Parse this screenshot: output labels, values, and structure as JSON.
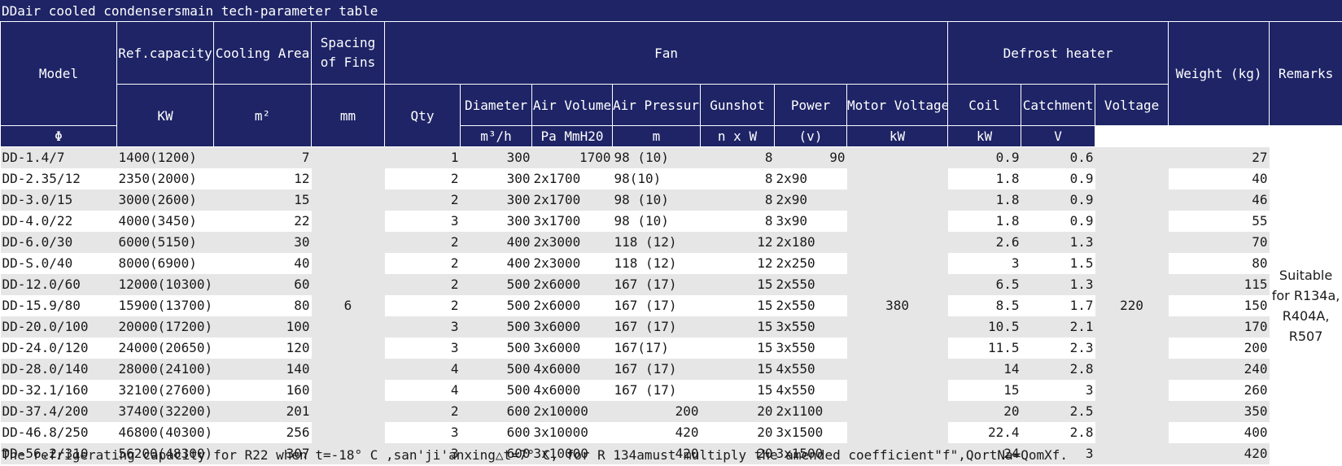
{
  "caption": "DDair cooled condensersmain tech-parameter table",
  "headers": {
    "model": "Model",
    "ref_capacity": "Ref.capacity",
    "cooling_area": "Cooling Area",
    "spacing_of_fins": "Spacing of Fins",
    "fan": "Fan",
    "defrost_heater": "Defrost heater",
    "weight": "Weight (kg)",
    "remarks": "Remarks",
    "qty": "Qty",
    "diameter": "Diameter",
    "air_volume": "Air Volume",
    "air_pressure": "Air Pressure",
    "gunshot": "Gunshot",
    "power": "Power",
    "motor_voltage": "Motor Voltage",
    "coil": "Coil",
    "catchment": "Catchment",
    "voltage": "Voltage",
    "unit_kw": "KW",
    "unit_m2": "m²",
    "unit_mm": "mm",
    "unit_diameter": "Φ",
    "unit_air_volume": "m³/h",
    "unit_air_pressure": "Pa  MmH20",
    "unit_gunshot": "m",
    "unit_power": "n x W",
    "unit_motor_voltage": "(v)",
    "unit_coil": "kW",
    "unit_catchment": "kW",
    "unit_voltage": "V"
  },
  "shared": {
    "spacing_of_fins": "6",
    "motor_voltage": "380",
    "heater_voltage": "220",
    "remarks": "Suitable for R134a, R404A, R507"
  },
  "rows": [
    {
      "model": "DD-1.4/7",
      "capacity": "1400(1200)",
      "area": "7",
      "qty": "1",
      "diameter": "300",
      "air_volume": "1700",
      "air_pressure": "98 (10)",
      "gunshot": "8",
      "power": "90",
      "coil": "0.9",
      "catchment": "0.6",
      "weight": "27"
    },
    {
      "model": "DD-2.35/12",
      "capacity": "2350(2000)",
      "area": "12",
      "qty": "2",
      "diameter": "300",
      "air_volume": "2x1700",
      "air_pressure": "98(10)",
      "gunshot": "8",
      "power": "2x90",
      "coil": "1.8",
      "catchment": "0.9",
      "weight": "40"
    },
    {
      "model": "DD-3.0/15",
      "capacity": "3000(2600)",
      "area": "15",
      "qty": "2",
      "diameter": "300",
      "air_volume": "2x1700",
      "air_pressure": "98 (10)",
      "gunshot": "8",
      "power": "2x90",
      "coil": "1.8",
      "catchment": "0.9",
      "weight": "46"
    },
    {
      "model": "DD-4.0/22",
      "capacity": "4000(3450)",
      "area": "22",
      "qty": "3",
      "diameter": "300",
      "air_volume": "3x1700",
      "air_pressure": "98 (10)",
      "gunshot": "8",
      "power": "3x90",
      "coil": "1.8",
      "catchment": "0.9",
      "weight": "55"
    },
    {
      "model": "DD-6.0/30",
      "capacity": "6000(5150)",
      "area": "30",
      "qty": "2",
      "diameter": "400",
      "air_volume": "2x3000",
      "air_pressure": "118 (12)",
      "gunshot": "12",
      "power": "2x180",
      "coil": "2.6",
      "catchment": "1.3",
      "weight": "70"
    },
    {
      "model": "DD-S.0/40",
      "capacity": "8000(6900)",
      "area": "40",
      "qty": "2",
      "diameter": "400",
      "air_volume": "2x3000",
      "air_pressure": "118 (12)",
      "gunshot": "12",
      "power": "2x250",
      "coil": "3",
      "catchment": "1.5",
      "weight": "80"
    },
    {
      "model": "DD-12.0/60",
      "capacity": "12000(10300)",
      "area": "60",
      "qty": "2",
      "diameter": "500",
      "air_volume": "2x6000",
      "air_pressure": "167 (17)",
      "gunshot": "15",
      "power": "2x550",
      "coil": "6.5",
      "catchment": "1.3",
      "weight": "115"
    },
    {
      "model": "DD-15.9/80",
      "capacity": "15900(13700)",
      "area": "80",
      "qty": "2",
      "diameter": "500",
      "air_volume": "2x6000",
      "air_pressure": "167 (17)",
      "gunshot": "15",
      "power": "2x550",
      "coil": "8.5",
      "catchment": "1.7",
      "weight": "150"
    },
    {
      "model": "DD-20.0/100",
      "capacity": "20000(17200)",
      "area": "100",
      "qty": "3",
      "diameter": "500",
      "air_volume": "3x6000",
      "air_pressure": "167 (17)",
      "gunshot": "15",
      "power": "3x550",
      "coil": "10.5",
      "catchment": "2.1",
      "weight": "170"
    },
    {
      "model": "DD-24.0/120",
      "capacity": "24000(20650)",
      "area": "120",
      "qty": "3",
      "diameter": "500",
      "air_volume": "3x6000",
      "air_pressure": "167(17)",
      "gunshot": "15",
      "power": "3x550",
      "coil": "11.5",
      "catchment": "2.3",
      "weight": "200"
    },
    {
      "model": "DD-28.0/140",
      "capacity": "28000(24100)",
      "area": "140",
      "qty": "4",
      "diameter": "500",
      "air_volume": "4x6000",
      "air_pressure": "167 (17)",
      "gunshot": "15",
      "power": "4x550",
      "coil": "14",
      "catchment": "2.8",
      "weight": "240"
    },
    {
      "model": "DD-32.1/160",
      "capacity": "32100(27600)",
      "area": "160",
      "qty": "4",
      "diameter": "500",
      "air_volume": "4x6000",
      "air_pressure": "167 (17)",
      "gunshot": "15",
      "power": "4x550",
      "coil": "15",
      "catchment": "3",
      "weight": "260"
    },
    {
      "model": "DD-37.4/200",
      "capacity": "37400(32200)",
      "area": "201",
      "qty": "2",
      "diameter": "600",
      "air_volume": "2x10000",
      "air_pressure": "200",
      "gunshot": "20",
      "power": "2x1100",
      "coil": "20",
      "catchment": "2.5",
      "weight": "350"
    },
    {
      "model": "DD-46.8/250",
      "capacity": "46800(40300)",
      "area": "256",
      "qty": "3",
      "diameter": "600",
      "air_volume": "3x10000",
      "air_pressure": "420",
      "gunshot": "20",
      "power": "3x1500",
      "coil": "22.4",
      "catchment": "2.8",
      "weight": "400"
    },
    {
      "model": "DD-56.2/310",
      "capacity": "56200(48300)",
      "area": "307",
      "qty": "3",
      "diameter": "600",
      "air_volume": "3x10000",
      "air_pressure": "420",
      "gunshot": "20",
      "power": "3x1500",
      "coil": "24",
      "catchment": "3",
      "weight": "420"
    }
  ],
  "footnote": "The refrigerating capacity for R22 when t=-18° C ,san'ji'anxing△t=7° C, for R 134amust multiply the amended coefficient\"f\",QortNa=QomXf."
}
